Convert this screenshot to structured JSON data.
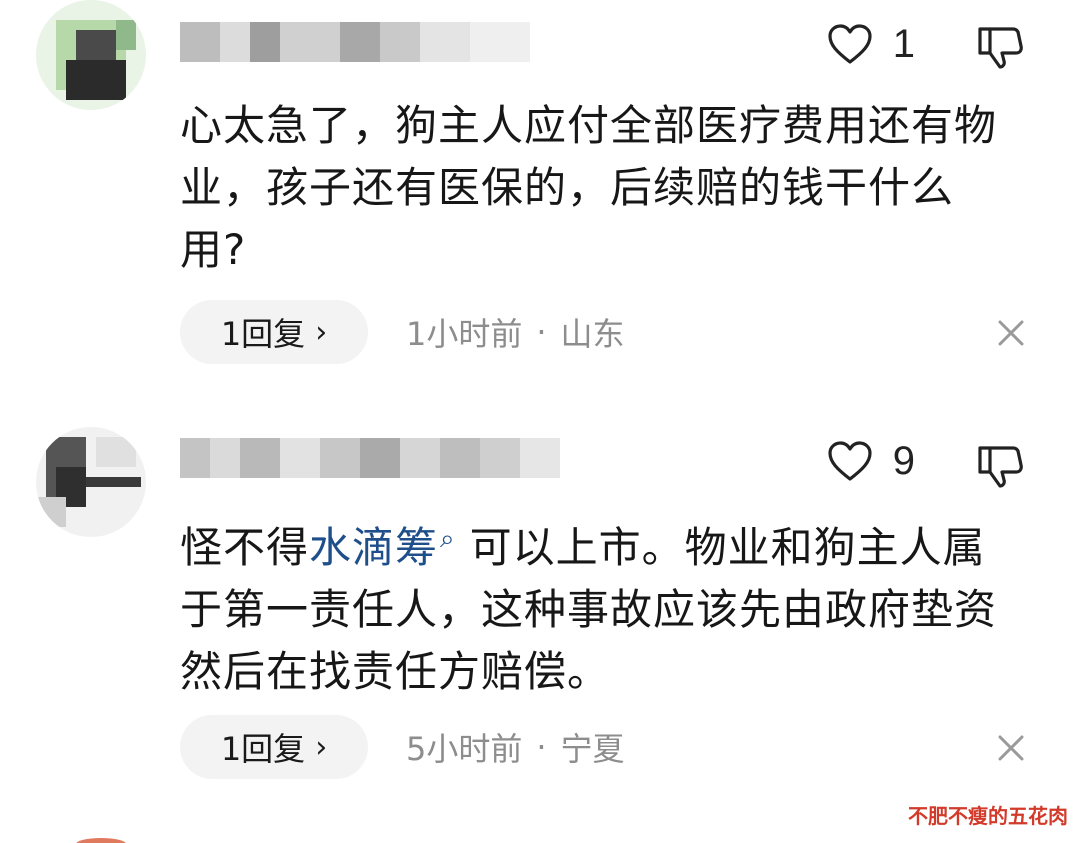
{
  "comments": [
    {
      "likes": "1",
      "text": "心太急了，狗主人应付全部医疗费用还有物业，孩子还有医保的，后续赔的钱干什么用?",
      "reply_label": "1回复",
      "time": "1小时前",
      "location": "山东"
    },
    {
      "likes": "9",
      "text_before": "怪不得",
      "link_text": "水滴筹",
      "text_after": "可以上市。物业和狗主人属于第一责任人，这种事故应该先由政府垫资然后在找责任方赔偿。",
      "reply_label": "1回复",
      "time": "5小时前",
      "location": "宁夏"
    }
  ],
  "separator": "·",
  "watermark": "不肥不瘦的五花肉",
  "icons": {
    "like": "heart-outline-icon",
    "dislike": "thumbs-down-outline-icon",
    "close": "close-icon",
    "search": "search-icon",
    "chevron": "chevron-right-icon"
  },
  "colors": {
    "text": "#171717",
    "meta": "#8d8d8d",
    "link": "#1f4f8a",
    "pill_bg": "#f3f3f3",
    "watermark": "#d23a2a"
  }
}
